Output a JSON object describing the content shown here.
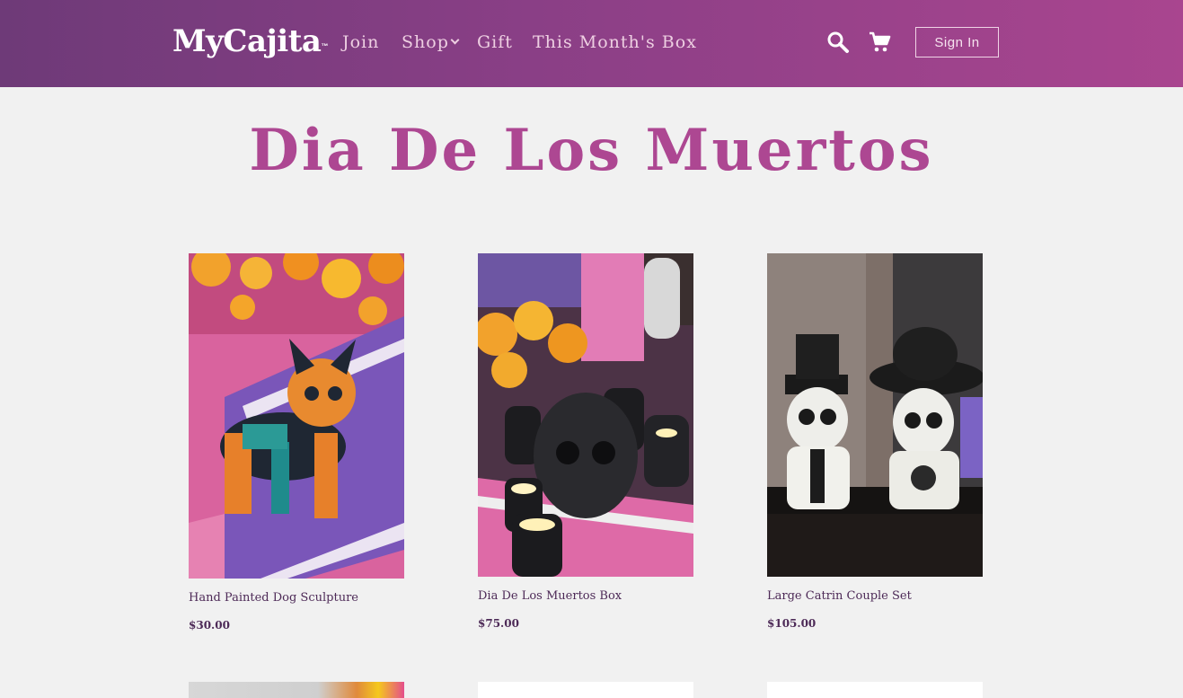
{
  "header": {
    "logo": "MyCajita",
    "logo_tm": "™",
    "nav": {
      "join": "Join",
      "shop": "Shop",
      "gift": "Gift",
      "this_months_box": "This Month's Box"
    },
    "icons": [
      "search-icon",
      "cart-icon",
      "chevron-down-icon"
    ],
    "sign_in": "Sign In"
  },
  "page": {
    "title": "Dia De Los Muertos"
  },
  "products": [
    {
      "name": "Hand Painted Dog Sculpture",
      "price": "$30.00"
    },
    {
      "name": "Dia De Los Muertos Box",
      "price": "$75.00"
    },
    {
      "name": "Large Catrin Couple Set",
      "price": "$105.00"
    }
  ],
  "colors": {
    "header_start": "#6e3a78",
    "header_end": "#a9458f",
    "title": "#ad4792",
    "product_text": "#4d2a57",
    "background": "#f1f1f1"
  }
}
